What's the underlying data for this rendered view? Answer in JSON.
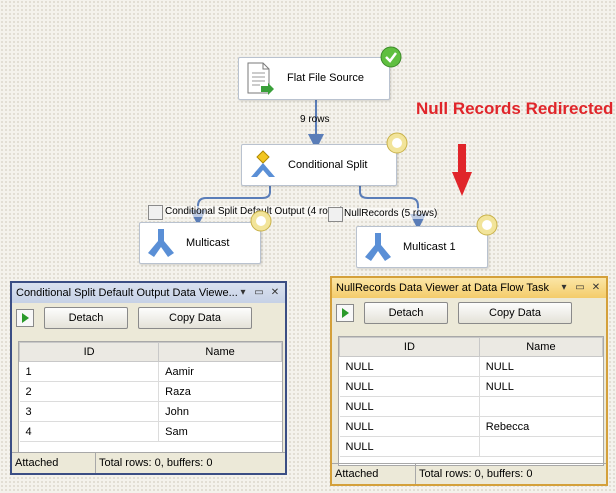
{
  "flow": {
    "source": {
      "label": "Flat File Source",
      "status_icon": "check-icon"
    },
    "path_main": {
      "label": "9 rows"
    },
    "split": {
      "label": "Conditional Split"
    },
    "path_default": {
      "label": "Conditional Split Default Output (4 rows)"
    },
    "path_null": {
      "label": "NullRecords (5 rows)"
    },
    "multicast_a": {
      "label": "Multicast"
    },
    "multicast_b": {
      "label": "Multicast 1"
    }
  },
  "annotation": {
    "text": "Null Records Redirected",
    "color": "#e0252a"
  },
  "viewers": [
    {
      "title": "Conditional Split Default Output Data Viewe...",
      "detach": "Detach",
      "copy": "Copy Data",
      "columns": [
        "ID",
        "Name"
      ],
      "rows": [
        [
          "1",
          "Aamir"
        ],
        [
          "2",
          "Raza"
        ],
        [
          "3",
          "John"
        ],
        [
          "4",
          "Sam"
        ]
      ],
      "status_attached": "Attached",
      "status_total": "Total rows: 0, buffers: 0"
    },
    {
      "title": "NullRecords Data Viewer at Data Flow Task",
      "detach": "Detach",
      "copy": "Copy Data",
      "columns": [
        "ID",
        "Name"
      ],
      "rows": [
        [
          "NULL",
          "NULL"
        ],
        [
          "NULL",
          "NULL"
        ],
        [
          "NULL",
          ""
        ],
        [
          "NULL",
          "Rebecca"
        ],
        [
          "NULL",
          ""
        ]
      ],
      "status_attached": "Attached",
      "status_total": "Total rows: 0, buffers: 0"
    }
  ],
  "colors": {
    "accent_border": "#3b4e84",
    "active_border": "#d4a03a",
    "path_arrow": "#5a7db8",
    "null_arrow": "#e0252a"
  }
}
